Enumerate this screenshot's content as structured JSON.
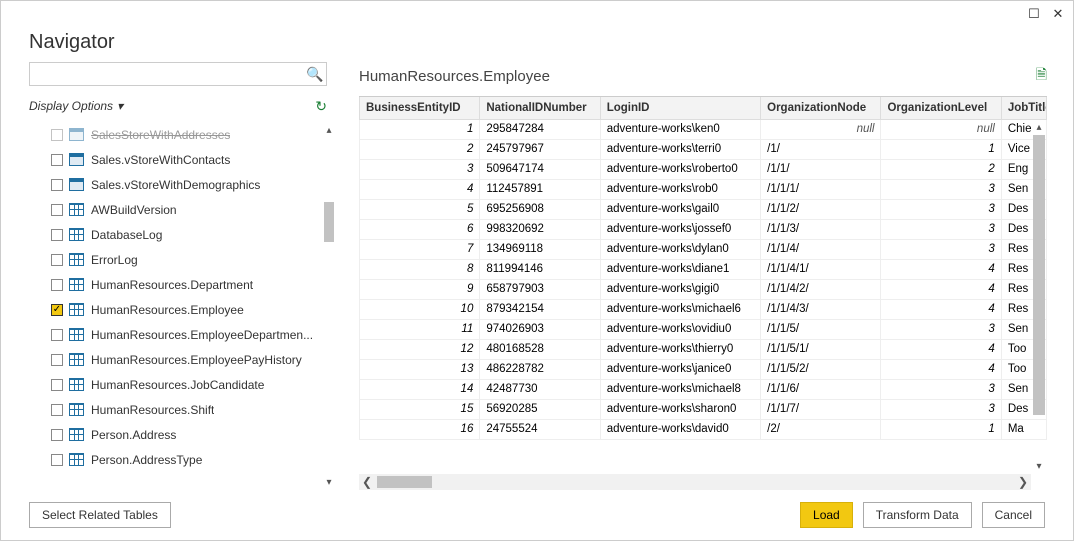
{
  "titlebar": {
    "maximize_glyph": "☐",
    "close_glyph": "✕"
  },
  "header": {
    "title": "Navigator"
  },
  "sidebar": {
    "search_placeholder": "",
    "search_glyph": "🔍",
    "display_options_label": "Display Options",
    "refresh_glyph": "↻",
    "items": [
      {
        "label": "SalesStoreWithAddresses",
        "icon": "view",
        "checked": false,
        "strikethrough": true
      },
      {
        "label": "Sales.vStoreWithContacts",
        "icon": "view",
        "checked": false
      },
      {
        "label": "Sales.vStoreWithDemographics",
        "icon": "view",
        "checked": false
      },
      {
        "label": "AWBuildVersion",
        "icon": "table",
        "checked": false
      },
      {
        "label": "DatabaseLog",
        "icon": "table",
        "checked": false
      },
      {
        "label": "ErrorLog",
        "icon": "table",
        "checked": false
      },
      {
        "label": "HumanResources.Department",
        "icon": "table",
        "checked": false
      },
      {
        "label": "HumanResources.Employee",
        "icon": "table",
        "checked": true
      },
      {
        "label": "HumanResources.EmployeeDepartmen...",
        "icon": "table",
        "checked": false
      },
      {
        "label": "HumanResources.EmployeePayHistory",
        "icon": "table",
        "checked": false
      },
      {
        "label": "HumanResources.JobCandidate",
        "icon": "table",
        "checked": false
      },
      {
        "label": "HumanResources.Shift",
        "icon": "table",
        "checked": false
      },
      {
        "label": "Person.Address",
        "icon": "table",
        "checked": false
      },
      {
        "label": "Person.AddressType",
        "icon": "table",
        "checked": false
      }
    ]
  },
  "preview": {
    "title": "HumanResources.Employee",
    "action_glyph": "🗎",
    "columns": [
      "BusinessEntityID",
      "NationalIDNumber",
      "LoginID",
      "OrganizationNode",
      "OrganizationLevel",
      "JobTitle"
    ],
    "rows": [
      [
        "1",
        "295847284",
        "adventure-works\\ken0",
        "null",
        "null",
        "Chie"
      ],
      [
        "2",
        "245797967",
        "adventure-works\\terri0",
        "/1/",
        "1",
        "Vice"
      ],
      [
        "3",
        "509647174",
        "adventure-works\\roberto0",
        "/1/1/",
        "2",
        "Eng"
      ],
      [
        "4",
        "112457891",
        "adventure-works\\rob0",
        "/1/1/1/",
        "3",
        "Sen"
      ],
      [
        "5",
        "695256908",
        "adventure-works\\gail0",
        "/1/1/2/",
        "3",
        "Des"
      ],
      [
        "6",
        "998320692",
        "adventure-works\\jossef0",
        "/1/1/3/",
        "3",
        "Des"
      ],
      [
        "7",
        "134969118",
        "adventure-works\\dylan0",
        "/1/1/4/",
        "3",
        "Res"
      ],
      [
        "8",
        "811994146",
        "adventure-works\\diane1",
        "/1/1/4/1/",
        "4",
        "Res"
      ],
      [
        "9",
        "658797903",
        "adventure-works\\gigi0",
        "/1/1/4/2/",
        "4",
        "Res"
      ],
      [
        "10",
        "879342154",
        "adventure-works\\michael6",
        "/1/1/4/3/",
        "4",
        "Res"
      ],
      [
        "11",
        "974026903",
        "adventure-works\\ovidiu0",
        "/1/1/5/",
        "3",
        "Sen"
      ],
      [
        "12",
        "480168528",
        "adventure-works\\thierry0",
        "/1/1/5/1/",
        "4",
        "Too"
      ],
      [
        "13",
        "486228782",
        "adventure-works\\janice0",
        "/1/1/5/2/",
        "4",
        "Too"
      ],
      [
        "14",
        "42487730",
        "adventure-works\\michael8",
        "/1/1/6/",
        "3",
        "Sen"
      ],
      [
        "15",
        "56920285",
        "adventure-works\\sharon0",
        "/1/1/7/",
        "3",
        "Des"
      ],
      [
        "16",
        "24755524",
        "adventure-works\\david0",
        "/2/",
        "1",
        "Ma"
      ]
    ]
  },
  "footer": {
    "select_related": "Select Related Tables",
    "load": "Load",
    "transform": "Transform Data",
    "cancel": "Cancel"
  }
}
